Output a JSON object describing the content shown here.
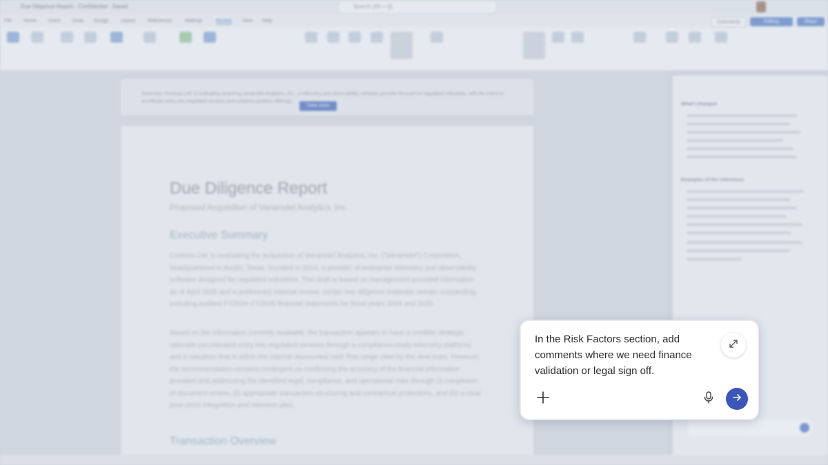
{
  "title_bar": {
    "doc_title": "Due Diligence Report  ·  Confidential  ·  Saved",
    "search_placeholder": "Search (Alt + Q)"
  },
  "menu": {
    "items": [
      "File",
      "Home",
      "Insert",
      "Draw",
      "Design",
      "Layout",
      "References",
      "Mailings",
      "Review",
      "View",
      "Help"
    ],
    "active": "Review",
    "buttons": {
      "comments": "Comments",
      "editing": "Editing",
      "share": "Share"
    }
  },
  "banner": {
    "text": "Summary: Contoso Ltd. is evaluating acquiring Vanarsdel Analytics, Inc., a telemetry and observability software provider focused on regulated industries, with the intent to accelerate entry into regulated services and enhance product offerings.",
    "button_label": "View more"
  },
  "document": {
    "title": "Due Diligence Report",
    "subtitle": "Proposed Acquisition of Vanarsdel Analytics, Inc.",
    "heading1": "Executive Summary",
    "paragraph1": "Contoso Ltd. is evaluating the acquisition of Vanarsdel Analytics, Inc. (\"Vanarsdel\") Corporation, headquartered in Austin, Texas, founded in 2014, a provider of enterprise telemetry and observability software designed for regulated industries. This draft is based on management-provided information as of April 2025 and a preliminary internal review; certain key diligence materials remain outstanding, including audited FY2024–FY2025 financial statements for fiscal years 2024 and 2025.",
    "paragraph2": "Based on the information currently available, the transaction appears to have a credible strategic rationale (accelerated entry into regulated services through a compliance-ready telemetry platform) and a valuation that is within the internal discounted cash flow range cited by the deal team. However, the recommendation remains contingent on confirming the accuracy of the financial information provided and addressing the identified legal, compliance, and operational risks through (i) completion of document review, (ii) appropriate transaction structuring and contractual protections, and (iii) a clear post-close integration and retention plan.",
    "heading2": "Transaction Overview"
  },
  "side_panel": {
    "heading1": "What I changed",
    "heading2": "Examples of the references"
  },
  "prompt": {
    "text": "In the Risk Factors section, add comments where we need finance validation or legal sign off.",
    "expand_icon": "expand-diagonal-icon",
    "add_icon": "plus-icon",
    "mic_icon": "microphone-icon",
    "send_icon": "arrow-right-icon",
    "send_color": "#3b55b9"
  }
}
